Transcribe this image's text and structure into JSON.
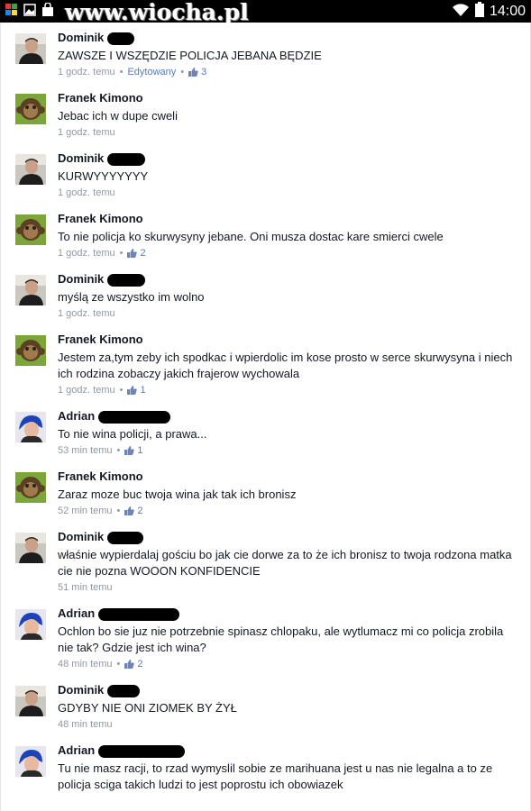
{
  "status_bar": {
    "time": "14:00",
    "watermark": "www.wiocha.pl",
    "icons": [
      "app-icon",
      "photo-icon",
      "shopping-bag-icon",
      "wifi-icon",
      "battery-icon"
    ]
  },
  "colors": {
    "name": "#141823",
    "meta": "#9197a3",
    "link": "#5b7bb2"
  },
  "comments": [
    {
      "author": "Dominik",
      "avatar": "dominik-avatar",
      "text": "ZAWSZE I WSZĘDZIE POLICJA JEBANA BĘDZIE",
      "time": "1 godz. temu",
      "edited": "Edytowany",
      "likes": "3"
    },
    {
      "author": "Franek Kimono",
      "avatar": "franek-avatar",
      "text": "Jebac ich w dupe cweli",
      "time": "1 godz. temu",
      "edited": "",
      "likes": ""
    },
    {
      "author": "Dominik",
      "avatar": "dominik-avatar",
      "text": "KURWYYYYYYY",
      "time": "1 godz. temu",
      "edited": "",
      "likes": ""
    },
    {
      "author": "Franek Kimono",
      "avatar": "franek-avatar",
      "text": "To nie policja ko skurwysyny jebane. Oni musza dostac kare smierci cwele",
      "time": "1 godz. temu",
      "edited": "",
      "likes": "2"
    },
    {
      "author": "Dominik",
      "avatar": "dominik-avatar",
      "text": "myślą ze wszystko im wolno",
      "time": "1 godz. temu",
      "edited": "",
      "likes": ""
    },
    {
      "author": "Franek Kimono",
      "avatar": "franek-avatar",
      "text": "Jestem za,tym zeby ich spodkac i wpierdolic im kose prosto w serce skurwysyna i niech ich rodzina zobaczy jakich frajerow wychowala",
      "time": "1 godz. temu",
      "edited": "",
      "likes": "1"
    },
    {
      "author": "Adrian",
      "avatar": "adrian-avatar",
      "text": "To nie wina policji, a prawa...",
      "time": "53 min temu",
      "edited": "",
      "likes": "1"
    },
    {
      "author": "Franek Kimono",
      "avatar": "franek-avatar",
      "text": "Zaraz moze buc twoja wina jak tak ich bronisz",
      "time": "52 min temu",
      "edited": "",
      "likes": "2"
    },
    {
      "author": "Dominik",
      "avatar": "dominik-avatar",
      "text": "właśnie wypierdalaj gościu bo jak cie dorwe za to że ich bronisz to twoja rodzona matka cie nie pozna WOOON KONFIDENCIE",
      "time": "51 min temu",
      "edited": "",
      "likes": ""
    },
    {
      "author": "Adrian",
      "avatar": "adrian-avatar",
      "text": "Ochlon bo sie juz nie potrzebnie spinasz chlopaku, ale wytlumacz mi co policja zrobila nie tak? Gdzie jest ich wina?",
      "time": "48 min temu",
      "edited": "",
      "likes": "2"
    },
    {
      "author": "Dominik",
      "avatar": "dominik-avatar",
      "text": "GDYBY NIE ONI ZIOMEK BY ŻYŁ",
      "time": "48 min temu",
      "edited": "",
      "likes": ""
    },
    {
      "author": "Adrian",
      "avatar": "adrian-avatar",
      "text": "Tu nie masz racji, to rzad wymyslil sobie ze marihuana jest u nas nie legalna a to ze policja sciga takich ludzi to jest poprostu ich obowiazek",
      "time": "",
      "edited": "",
      "likes": ""
    }
  ]
}
